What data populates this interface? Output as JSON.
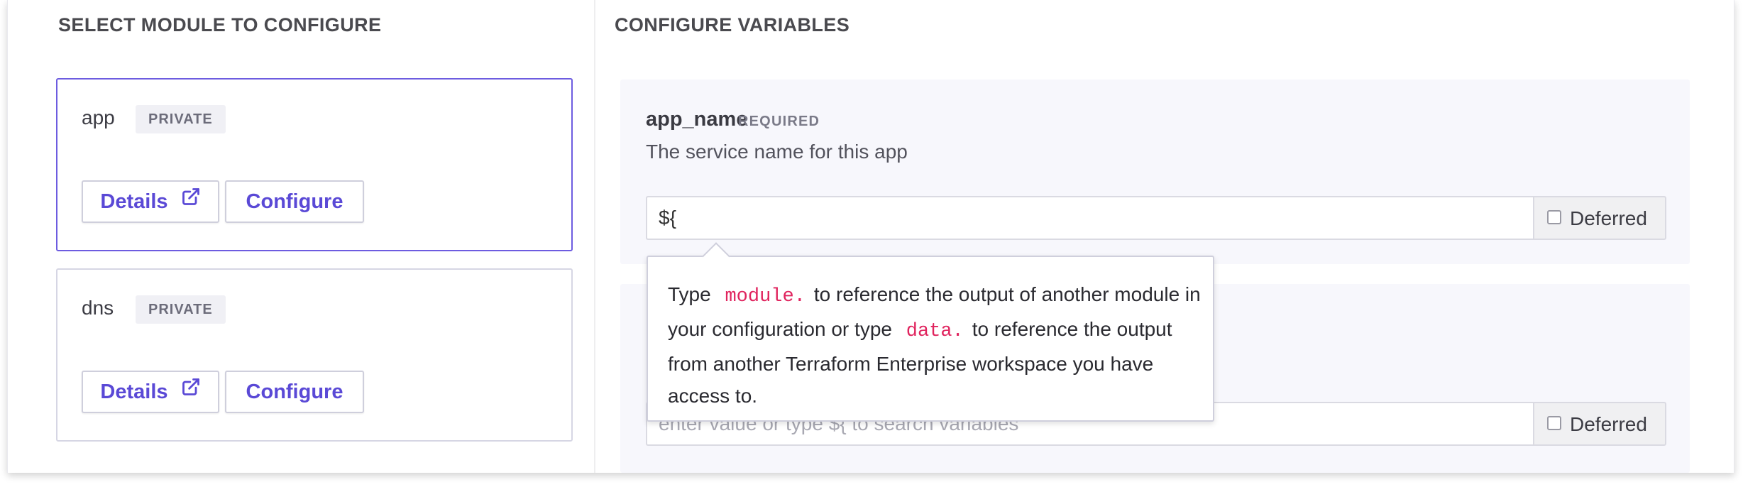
{
  "left_panel": {
    "title": "SELECT MODULE TO CONFIGURE",
    "modules": [
      {
        "name": "app",
        "badge": "PRIVATE",
        "details_label": "Details",
        "configure_label": "Configure",
        "selected": true
      },
      {
        "name": "dns",
        "badge": "PRIVATE",
        "details_label": "Details",
        "configure_label": "Configure",
        "selected": false
      }
    ]
  },
  "right_panel": {
    "title": "CONFIGURE VARIABLES",
    "variables": [
      {
        "name": "app_name",
        "required_label": "REQUIRED",
        "description": "The service name for this app",
        "value": "${",
        "placeholder": "",
        "deferred_label": "Deferred",
        "deferred_checked": false
      },
      {
        "name": "",
        "required_label": "",
        "description": "",
        "value": "",
        "placeholder": "enter value or type ${ to search variables",
        "deferred_label": "Deferred",
        "deferred_checked": false
      }
    ]
  },
  "tooltip": {
    "type_word": "Type",
    "module_code": "module.",
    "text_a": "to reference the output of another module in your configuration or type",
    "data_code": "data.",
    "text_b": "to reference the output from another Terraform Enterprise workspace you have access to."
  },
  "icons": {
    "details_icon": "external-link-icon",
    "deferred_icon": "checkbox-icon"
  },
  "colors": {
    "accent": "#5a49d6",
    "selected_border": "#6d5ce0",
    "code": "#e0245e",
    "panel_bg": "#f7f7fc"
  }
}
